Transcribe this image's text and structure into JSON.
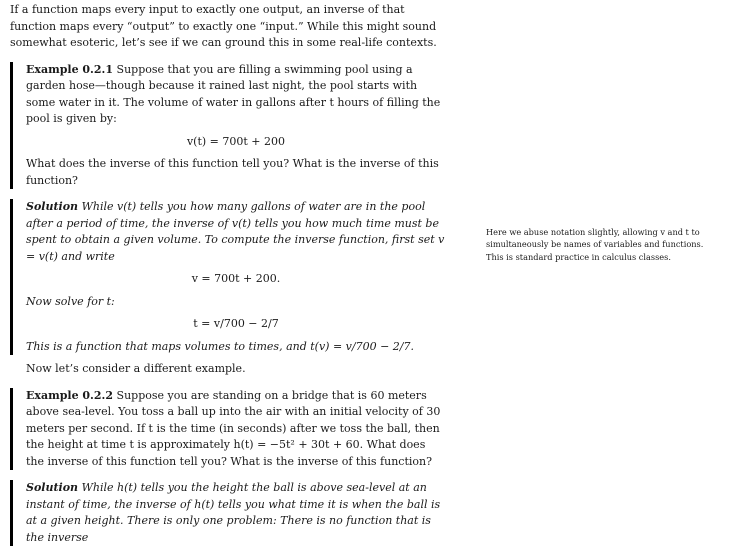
{
  "intro": "If a function maps every input to exactly one output, an inverse of that function maps every “output” to exactly one “input.” While this might sound somewhat esoteric, let’s see if we can ground this in some real-life contexts.",
  "ex1": {
    "label": "Example 0.2.1",
    "text": "Suppose that you are filling a swimming pool using a garden hose—though because it rained last night, the pool starts with some water in it. The volume of water in gallons after t hours of filling the pool is given by:",
    "eq": "v(t) = 700t + 200",
    "question": "What does the inverse of this function tell you? What is the inverse of this function?"
  },
  "sol1": {
    "label": "Solution",
    "text": "While v(t) tells you how many gallons of water are in the pool after a period of time, the inverse of v(t) tells you how much time must be spent to obtain a given volume. To compute the inverse function, first set v = v(t) and write",
    "eq1": "v = 700t + 200.",
    "mid": "Now solve for t:",
    "eq2": "t = v/700 − 2/7",
    "end": "This is a function that maps volumes to times, and t(v) = v/700 − 2/7."
  },
  "transition": "Now let’s consider a different example.",
  "ex2": {
    "label": "Example 0.2.2",
    "text": "Suppose you are standing on a bridge that is 60 meters above sea-level. You toss a ball up into the air with an initial velocity of 30 meters per second. If t is the time (in seconds) after we toss the ball, then the height at time t is approximately h(t) = −5t² + 30t + 60. What does the inverse of this function tell you? What is the inverse of this function?"
  },
  "sol2": {
    "label": "Solution",
    "text": "While h(t) tells you the height the ball is above sea-level at an instant of time, the inverse of h(t) tells you what time it is when the ball is at a given height. There is only one problem: There is no function that is the inverse"
  },
  "margin_note": "Here we abuse notation slightly, allowing v and t to simultaneously be names of variables and functions. This is standard practice in calculus classes."
}
